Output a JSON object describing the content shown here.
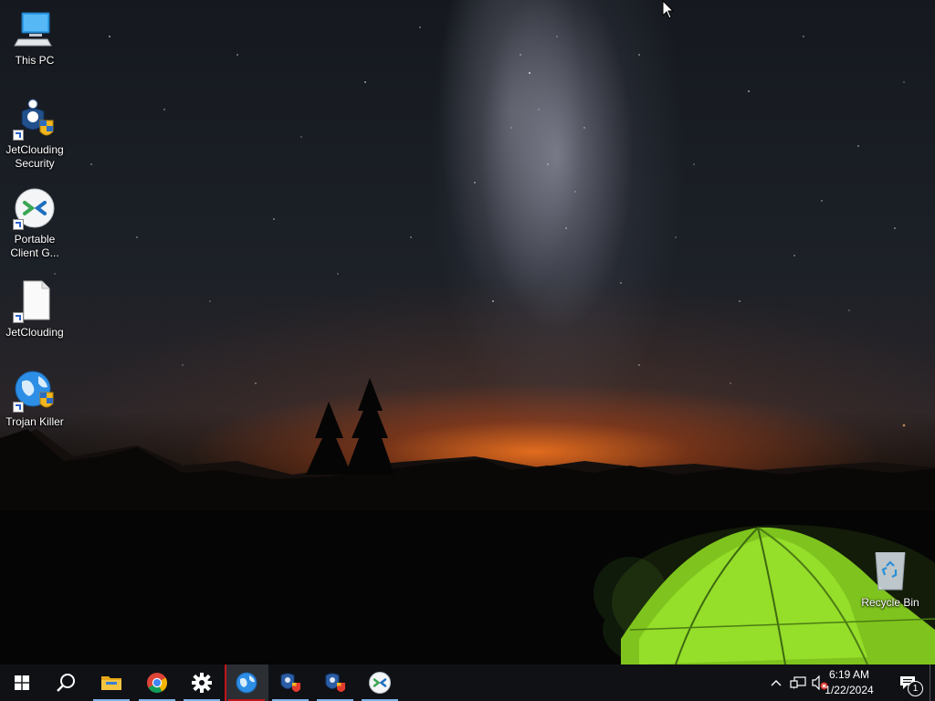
{
  "desktop": {
    "icons": [
      {
        "label": "This PC"
      },
      {
        "label": "JetClouding Security"
      },
      {
        "label": "Portable Client G..."
      },
      {
        "label": "JetClouding"
      },
      {
        "label": "Trojan Killer"
      },
      {
        "label": "Recycle Bin"
      }
    ]
  },
  "taskbar": {
    "apps": [
      {
        "name": "Start",
        "icon": "windows-logo-icon"
      },
      {
        "name": "Search",
        "icon": "search-icon"
      },
      {
        "name": "File Explorer",
        "icon": "folder-icon",
        "running": true
      },
      {
        "name": "Google Chrome",
        "icon": "chrome-icon",
        "running": true
      },
      {
        "name": "Settings",
        "icon": "gear-icon",
        "running": true
      },
      {
        "name": "Trojan Killer",
        "icon": "globe-shield-icon",
        "running": true,
        "active": true
      },
      {
        "name": "JetClouding Security",
        "icon": "shield-icon",
        "running": true
      },
      {
        "name": "JetClouding Security (2)",
        "icon": "shield-icon",
        "running": true
      },
      {
        "name": "Portable Client",
        "icon": "remote-client-icon",
        "running": true
      }
    ],
    "tray": {
      "time": "6:19 AM",
      "date": "1/22/2024",
      "notification_count": "1",
      "icons": [
        "chevron-up-icon",
        "network-icon",
        "volume-muted-icon"
      ]
    }
  },
  "colors": {
    "taskbar": "#0f1115",
    "active_indicator": "#c0151b",
    "running_indicator": "#7fb3e6"
  }
}
